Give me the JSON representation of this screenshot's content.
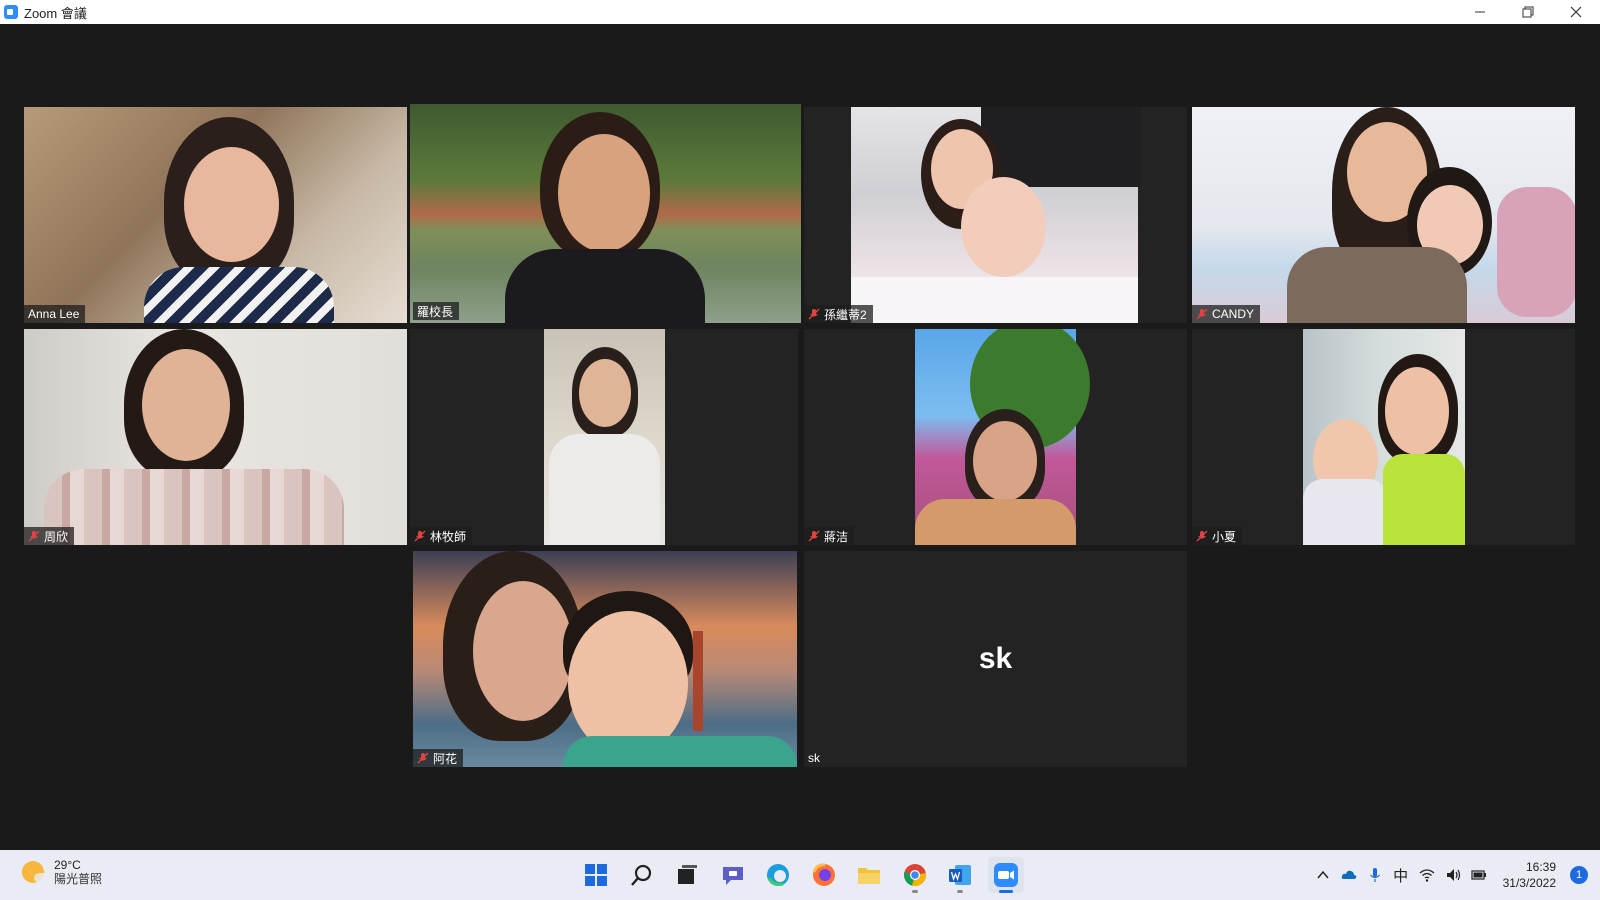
{
  "window": {
    "title": "Zoom 會議",
    "minimize": "─",
    "restore": "❐",
    "close": "✕"
  },
  "participants": [
    {
      "name": "Anna Lee",
      "muted": false,
      "active": false,
      "video": true
    },
    {
      "name": "羅校長",
      "muted": false,
      "active": true,
      "video": true
    },
    {
      "name": "孫繼蒂2",
      "muted": true,
      "active": false,
      "video": true
    },
    {
      "name": "CANDY",
      "muted": true,
      "active": false,
      "video": true
    },
    {
      "name": "周欣",
      "muted": true,
      "active": false,
      "video": true
    },
    {
      "name": "林牧師",
      "muted": true,
      "active": false,
      "video": true
    },
    {
      "name": "蔣洁",
      "muted": true,
      "active": false,
      "video": true
    },
    {
      "name": "小夏",
      "muted": true,
      "active": false,
      "video": true
    },
    {
      "name": "阿花",
      "muted": true,
      "active": false,
      "video": true
    },
    {
      "name": "sk",
      "muted": false,
      "active": false,
      "video": false,
      "avatar_text": "sk"
    }
  ],
  "taskbar": {
    "weather": {
      "temp": "29°C",
      "condition": "陽光普照"
    },
    "apps": [
      {
        "name": "start-icon",
        "active": false,
        "running": false
      },
      {
        "name": "search-icon",
        "active": false,
        "running": false
      },
      {
        "name": "task-view-icon",
        "active": false,
        "running": false
      },
      {
        "name": "teams-chat-icon",
        "active": false,
        "running": false
      },
      {
        "name": "edge-icon",
        "active": false,
        "running": false
      },
      {
        "name": "firefox-icon",
        "active": false,
        "running": false
      },
      {
        "name": "file-explorer-icon",
        "active": false,
        "running": false
      },
      {
        "name": "chrome-icon",
        "active": false,
        "running": true
      },
      {
        "name": "word-icon",
        "active": false,
        "running": true
      },
      {
        "name": "zoom-icon",
        "active": true,
        "running": true
      }
    ],
    "tray": {
      "chevron": "^",
      "ime": "中",
      "time": "16:39",
      "date": "31/3/2022",
      "notifications": "1"
    }
  },
  "colors": {
    "active_speaker_border": "#c9e43a",
    "muted_icon": "#e04343",
    "accent": "#1d6ae0"
  }
}
